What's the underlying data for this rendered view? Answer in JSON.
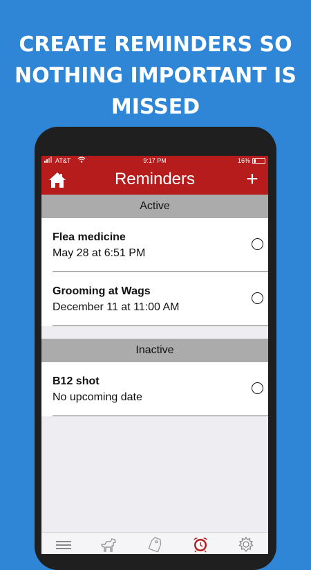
{
  "promo": {
    "headline_lines": [
      "CREATE REMINDERS SO",
      "NOTHING IMPORTANT IS",
      "MISSED"
    ]
  },
  "status_bar": {
    "carrier": "AT&T",
    "time": "9:17 PM",
    "battery": "16%"
  },
  "nav": {
    "title": "Reminders",
    "add_label": "+"
  },
  "sections": {
    "active": {
      "header": "Active",
      "items": [
        {
          "title": "Flea medicine",
          "subtitle": "May 28 at 6:51 PM"
        },
        {
          "title": "Grooming at Wags",
          "subtitle": "December 11 at 11:00 AM"
        }
      ]
    },
    "inactive": {
      "header": "Inactive",
      "items": [
        {
          "title": "B12 shot",
          "subtitle": "No upcoming date"
        }
      ]
    }
  },
  "tabbar": {
    "tabs": [
      {
        "icon": "menu-icon"
      },
      {
        "icon": "dog-icon"
      },
      {
        "icon": "tag-icon"
      },
      {
        "icon": "alarm-clock-icon",
        "active": true
      },
      {
        "icon": "gear-icon"
      }
    ]
  },
  "colors": {
    "background": "#2f86d6",
    "accent": "#b71c1c",
    "section_header": "#ababab"
  }
}
